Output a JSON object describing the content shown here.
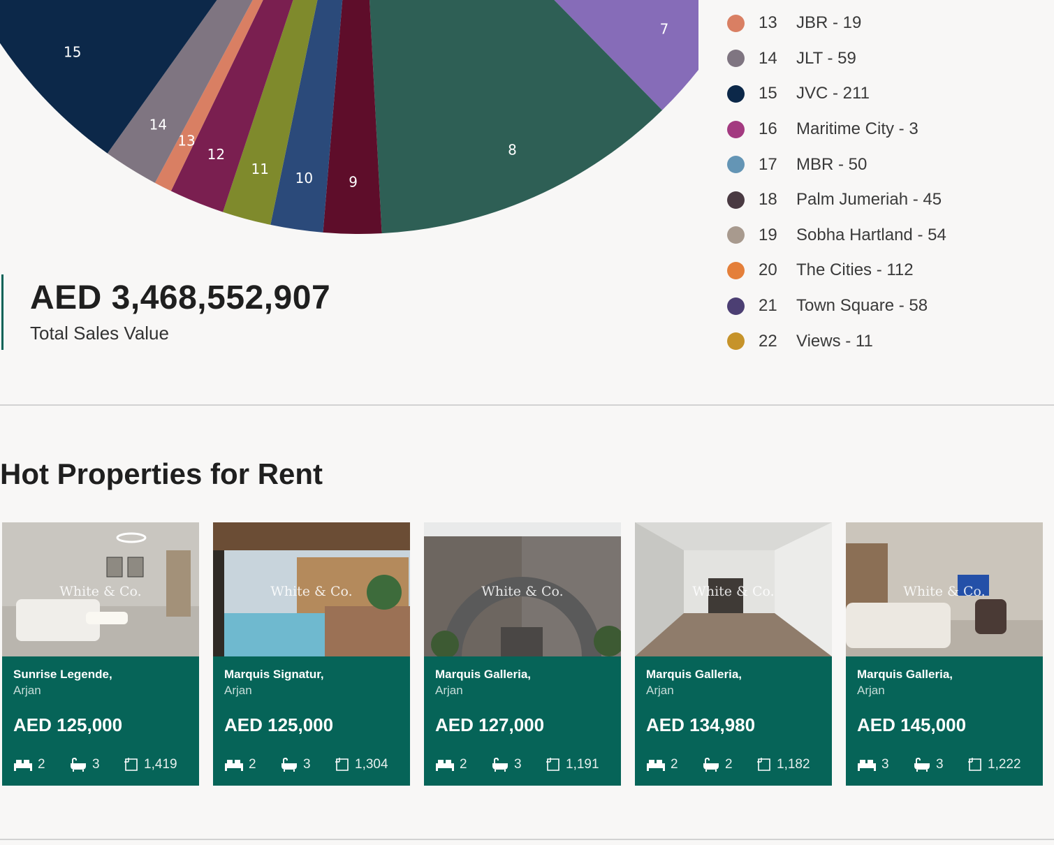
{
  "chart_data": {
    "type": "pie",
    "slices": [
      {
        "id": "7",
        "value": 140,
        "color": "#866cb8"
      },
      {
        "id": "8",
        "value": 330,
        "color": "#2e5f55"
      },
      {
        "id": "9",
        "value": 62,
        "color": "#5e0d2a"
      },
      {
        "id": "10",
        "value": 56,
        "color": "#2b4a7a"
      },
      {
        "id": "11",
        "value": 52,
        "color": "#7f8a2c"
      },
      {
        "id": "12",
        "value": 59,
        "color": "#7a1f50"
      },
      {
        "id": "13",
        "value": 19,
        "color": "#d97f63"
      },
      {
        "id": "14",
        "value": 59,
        "color": "#7f7581"
      },
      {
        "id": "15",
        "value": 211,
        "color": "#0c2849"
      }
    ],
    "partial_slices": [
      {
        "id": "6",
        "color": "#f0cb6a"
      }
    ],
    "legend": [
      {
        "num": "13",
        "text": "JBR - 19",
        "color": "#d97f63"
      },
      {
        "num": "14",
        "text": "JLT - 59",
        "color": "#7f7581"
      },
      {
        "num": "15",
        "text": "JVC - 211",
        "color": "#0c2849"
      },
      {
        "num": "16",
        "text": "Maritime City - 3",
        "color": "#a33a80"
      },
      {
        "num": "17",
        "text": "MBR - 50",
        "color": "#6495b5"
      },
      {
        "num": "18",
        "text": "Palm Jumeriah - 45",
        "color": "#4a3a42"
      },
      {
        "num": "19",
        "text": "Sobha Hartland - 54",
        "color": "#a89a8e"
      },
      {
        "num": "20",
        "text": "The Cities - 112",
        "color": "#e47f3a"
      },
      {
        "num": "21",
        "text": "Town Square - 58",
        "color": "#4c3f73"
      },
      {
        "num": "22",
        "text": "Views - 11",
        "color": "#c6932a"
      }
    ]
  },
  "summary": {
    "total_value": "AED 3,468,552,907",
    "total_label": "Total Sales Value"
  },
  "rentals": {
    "title": "Hot Properties for Rent",
    "watermark": "White & Co.",
    "cards": [
      {
        "name": "Sunrise Legende,",
        "area": "Arjan",
        "price": "AED 125,000",
        "beds": "2",
        "baths": "3",
        "size": "1,419",
        "photo": "living-room"
      },
      {
        "name": "Marquis Signatur,",
        "area": "Arjan",
        "price": "AED 125,000",
        "beds": "2",
        "baths": "3",
        "size": "1,304",
        "photo": "pool"
      },
      {
        "name": "Marquis Galleria,",
        "area": "Arjan",
        "price": "AED 127,000",
        "beds": "2",
        "baths": "3",
        "size": "1,191",
        "photo": "building"
      },
      {
        "name": "Marquis Galleria,",
        "area": "Arjan",
        "price": "AED 134,980",
        "beds": "2",
        "baths": "2",
        "size": "1,182",
        "photo": "empty-room"
      },
      {
        "name": "Marquis Galleria,",
        "area": "Arjan",
        "price": "AED 145,000",
        "beds": "3",
        "baths": "3",
        "size": "1,222",
        "photo": "lounge"
      }
    ]
  }
}
